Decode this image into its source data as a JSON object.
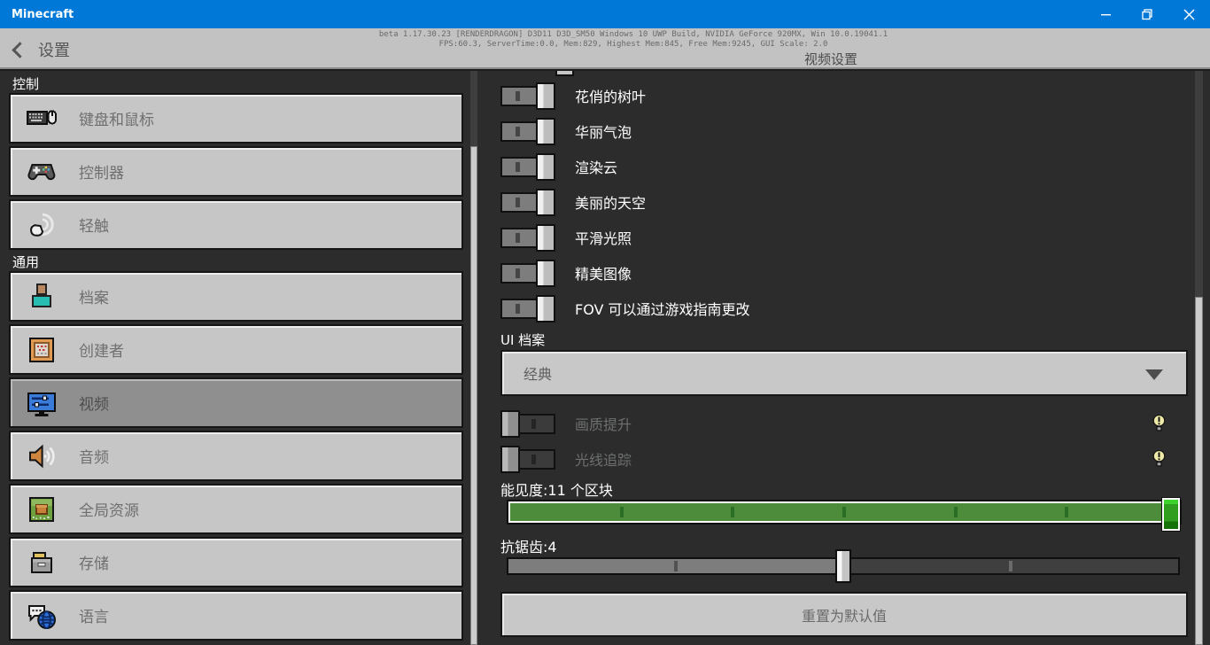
{
  "titlebar": {
    "app_title": "Minecraft"
  },
  "header": {
    "back_label": "设置",
    "page_title": "视频设置",
    "debug_line1": "beta 1.17.30.23 [RENDERDRAGON] D3D11 D3D_SM50 Windows 10 UWP Build, NVIDIA GeForce 920MX, Win 10.0.19041.1",
    "debug_line2": "FPS:60.3, ServerTime:0.0, Mem:829, Highest Mem:845, Free Mem:9245, GUI Scale: 2.0"
  },
  "sidebar": {
    "sections": [
      {
        "label": "控制",
        "items": [
          {
            "label": "键盘和鼠标",
            "icon": "keyboard-mouse-icon",
            "selected": false
          },
          {
            "label": "控制器",
            "icon": "controller-icon",
            "selected": false
          },
          {
            "label": "轻触",
            "icon": "touch-icon",
            "selected": false
          }
        ]
      },
      {
        "label": "通用",
        "items": [
          {
            "label": "档案",
            "icon": "profile-icon",
            "selected": false
          },
          {
            "label": "创建者",
            "icon": "creator-icon",
            "selected": false
          },
          {
            "label": "视频",
            "icon": "video-icon",
            "selected": true
          },
          {
            "label": "音频",
            "icon": "audio-icon",
            "selected": false
          },
          {
            "label": "全局资源",
            "icon": "global-resources-icon",
            "selected": false
          },
          {
            "label": "存储",
            "icon": "storage-icon",
            "selected": false
          },
          {
            "label": "语言",
            "icon": "language-icon",
            "selected": false
          }
        ]
      }
    ]
  },
  "panel": {
    "toggles_on": [
      "花俏的树叶",
      "华丽气泡",
      "渲染云",
      "美丽的天空",
      "平滑光照",
      "精美图像",
      "FOV 可以通过游戏指南更改"
    ],
    "ui_profile": {
      "label": "UI 档案",
      "value": "经典"
    },
    "toggles_disabled": [
      {
        "label": "画质提升",
        "info_icon": "lightbulb-icon"
      },
      {
        "label": "光线追踪",
        "info_icon": "lightbulb-icon"
      }
    ],
    "render_distance": {
      "label": "能见度:11 个区块",
      "value": 11,
      "unit": "个区块",
      "percent": 100
    },
    "antialiasing": {
      "label": "抗锯齿:4",
      "value": 4,
      "percent": 50
    },
    "reset_button": "重置为默认值"
  },
  "colors": {
    "titlebar_blue": "#0078d7",
    "header_gray": "#c2c2c2",
    "background": "#2c2c2c",
    "button_face": "#c6c6c6",
    "button_selected": "#8f8f8f",
    "slider_green_track": "#4d8c3a",
    "slider_green_knob": "#2f9e1f"
  }
}
